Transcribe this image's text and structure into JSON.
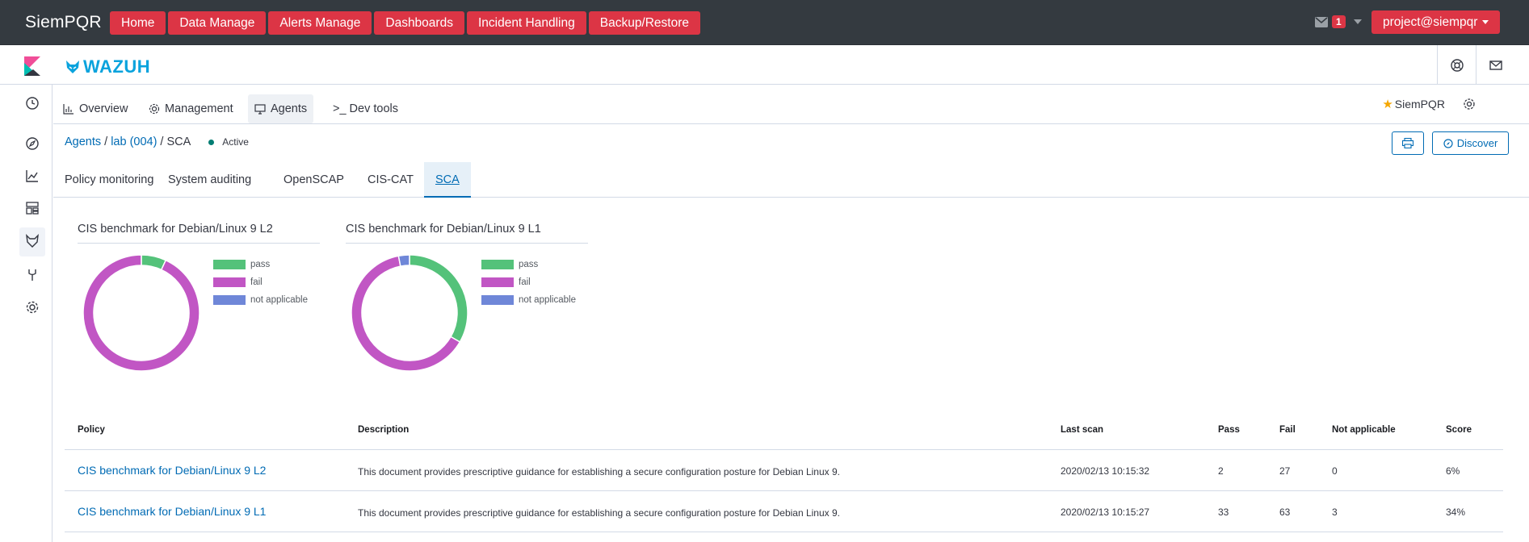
{
  "topbar": {
    "brand": "SiemPQR",
    "nav": [
      "Home",
      "Data Manage",
      "Alerts Manage",
      "Dashboards",
      "Incident Handling",
      "Backup/Restore"
    ],
    "mail_count": "1",
    "user": "project@siempqr"
  },
  "header": {
    "app_logo": "WAZUH"
  },
  "wazuh_menu": {
    "items": [
      "Overview",
      "Management",
      "Agents",
      ">_ Dev tools"
    ],
    "active": "Agents",
    "instance": "SiemPQR"
  },
  "breadcrumb": {
    "agents": "Agents",
    "agent": "lab (004)",
    "current": "SCA",
    "status": "Active",
    "discover_label": "Discover"
  },
  "tabs": {
    "items": [
      "Policy monitoring",
      "System auditing",
      "OpenSCAP",
      "CIS-CAT",
      "SCA"
    ],
    "active": "SCA"
  },
  "colors": {
    "pass": "#54c27a",
    "fail": "#c156c4",
    "not_applicable": "#6f87d8",
    "accent": "#dc3545",
    "link": "#006bb4"
  },
  "charts": {
    "legend": [
      "pass",
      "fail",
      "not applicable"
    ]
  },
  "chart_data": [
    {
      "type": "pie",
      "title": "CIS benchmark for Debian/Linux 9 L2",
      "categories": [
        "pass",
        "fail",
        "not applicable"
      ],
      "values": [
        2,
        27,
        0
      ]
    },
    {
      "type": "pie",
      "title": "CIS benchmark for Debian/Linux 9 L1",
      "categories": [
        "pass",
        "fail",
        "not applicable"
      ],
      "values": [
        33,
        63,
        3
      ]
    }
  ],
  "table": {
    "headers": [
      "Policy",
      "Description",
      "Last scan",
      "Pass",
      "Fail",
      "Not applicable",
      "Score"
    ],
    "rows": [
      [
        "CIS benchmark for Debian/Linux 9 L2",
        "This document provides prescriptive guidance for establishing a secure configuration posture for Debian Linux 9.",
        "2020/02/13 10:15:32",
        "2",
        "27",
        "0",
        "6%"
      ],
      [
        "CIS benchmark for Debian/Linux 9 L1",
        "This document provides prescriptive guidance for establishing a secure configuration posture for Debian Linux 9.",
        "2020/02/13 10:15:27",
        "33",
        "63",
        "3",
        "34%"
      ]
    ]
  }
}
